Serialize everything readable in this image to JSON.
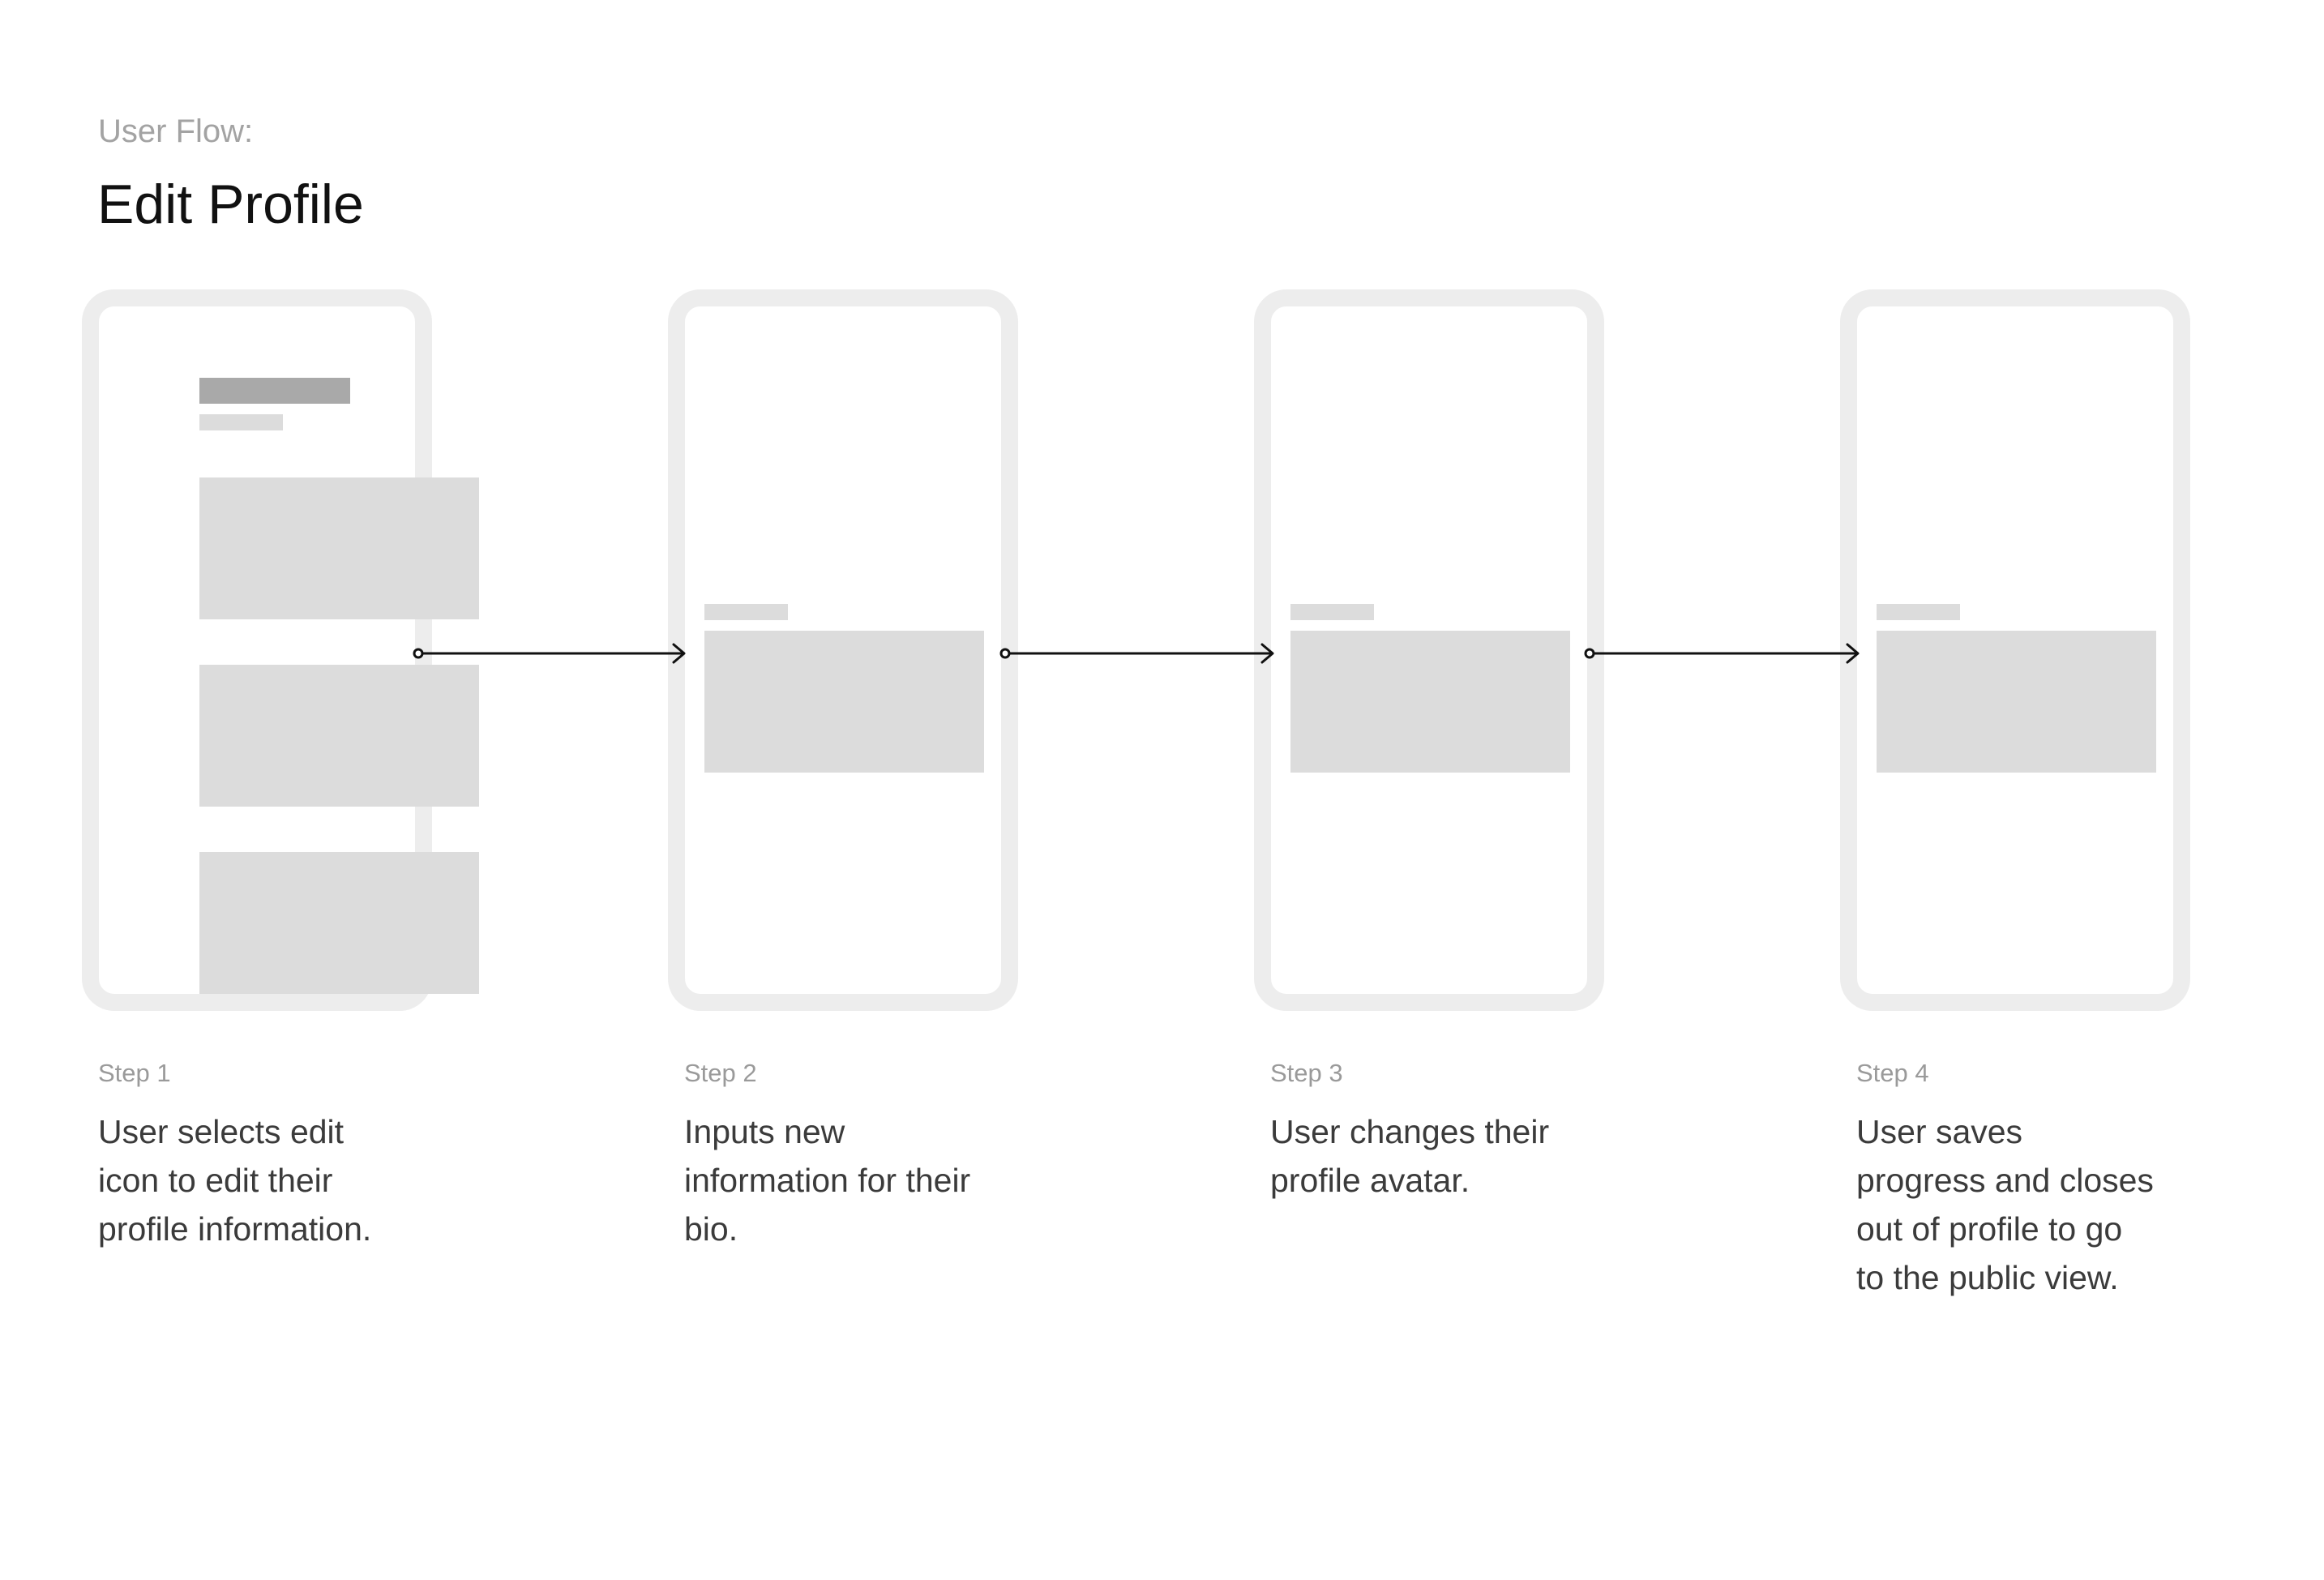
{
  "header": {
    "label": "User Flow:",
    "title": "Edit Profile"
  },
  "steps": [
    {
      "label": "Step 1",
      "description": [
        "User selects edit",
        "icon to edit their",
        "profile information."
      ]
    },
    {
      "label": "Step 2",
      "description": [
        "Inputs new",
        "information for their",
        "bio."
      ]
    },
    {
      "label": "Step 3",
      "description": [
        "User changes their",
        "profile avatar."
      ]
    },
    {
      "label": "Step 4",
      "description": [
        "User saves",
        "progress and closes",
        "out of profile to go",
        "to the public view."
      ]
    }
  ],
  "colors": {
    "frame": "#ededed",
    "placeholder": "#dcdcdc",
    "placeholder_dark": "#a9a9a9",
    "connector": "#111111"
  }
}
